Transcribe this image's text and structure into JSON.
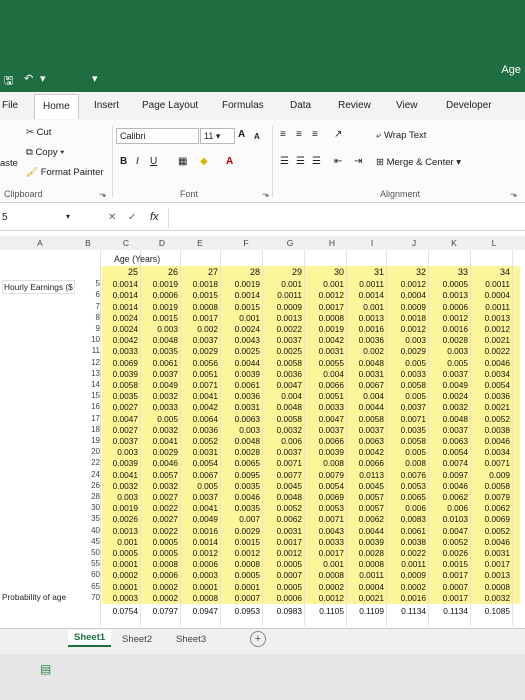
{
  "app": {
    "title": "Age"
  },
  "qat": {
    "save": "🖫",
    "undo": "↶",
    "redo": "▾",
    "customize": "▾"
  },
  "tabs": [
    "File",
    "Home",
    "Insert",
    "Page Layout",
    "Formulas",
    "Data",
    "Review",
    "View",
    "Developer"
  ],
  "ribbon": {
    "clipboard": {
      "cut": "Cut",
      "copy": "Copy",
      "format_painter": "Format Painter",
      "paste": "aste",
      "label": "Clipboard"
    },
    "font": {
      "name": "Calibri",
      "size": "11",
      "grow": "A",
      "shrink": "A",
      "bold": "B",
      "italic": "I",
      "underline": "U",
      "label": "Font"
    },
    "alignment": {
      "wrap": "Wrap Text",
      "merge": "Merge & Center",
      "label": "Alignment"
    }
  },
  "formula_bar": {
    "name_box": "5",
    "fx": "fx",
    "cancel": "✕",
    "enter": "✓"
  },
  "columns": [
    "A",
    "B",
    "C",
    "D",
    "E",
    "F",
    "G",
    "H",
    "I",
    "J",
    "K",
    "L"
  ],
  "side_labels": {
    "hourly": "Hourly Earnings ($",
    "probability": "Probability of age"
  },
  "age_label": "Age (Years)",
  "ages": [
    "25",
    "26",
    "27",
    "28",
    "29",
    "30",
    "31",
    "32",
    "33",
    "34"
  ],
  "rows": [
    {
      "n": "5",
      "v": [
        "0.0014",
        "0.0019",
        "0.0018",
        "0.0019",
        "0.001",
        "0.001",
        "0.0011",
        "0.0012",
        "0.0005",
        "0.0011"
      ]
    },
    {
      "n": "6",
      "v": [
        "0.0014",
        "0.0006",
        "0.0015",
        "0.0014",
        "0.0011",
        "0.0012",
        "0.0014",
        "0.0004",
        "0.0013",
        "0.0004"
      ]
    },
    {
      "n": "7",
      "v": [
        "0.0014",
        "0.0019",
        "0.0008",
        "0.0015",
        "0.0009",
        "0.0017",
        "0.001",
        "0.0009",
        "0.0006",
        "0.0011"
      ]
    },
    {
      "n": "8",
      "v": [
        "0.0024",
        "0.0015",
        "0.0017",
        "0.001",
        "0.0013",
        "0.0008",
        "0.0013",
        "0.0018",
        "0.0012",
        "0.0013"
      ]
    },
    {
      "n": "9",
      "v": [
        "0.0024",
        "0.003",
        "0.002",
        "0.0024",
        "0.0022",
        "0.0019",
        "0.0016",
        "0.0012",
        "0.0016",
        "0.0012"
      ]
    },
    {
      "n": "10",
      "v": [
        "0.0042",
        "0.0048",
        "0.0037",
        "0.0043",
        "0.0037",
        "0.0042",
        "0.0036",
        "0.003",
        "0.0028",
        "0.0021"
      ]
    },
    {
      "n": "11",
      "v": [
        "0.0033",
        "0.0035",
        "0.0029",
        "0.0025",
        "0.0025",
        "0.0031",
        "0.002",
        "0.0029",
        "0.003",
        "0.0022"
      ]
    },
    {
      "n": "12",
      "v": [
        "0.0069",
        "0.0061",
        "0.0056",
        "0.0044",
        "0.0058",
        "0.0055",
        "0.0048",
        "0.005",
        "0.005",
        "0.0046"
      ]
    },
    {
      "n": "13",
      "v": [
        "0.0039",
        "0.0037",
        "0.0051",
        "0.0039",
        "0.0036",
        "0.004",
        "0.0031",
        "0.0033",
        "0.0037",
        "0.0034"
      ]
    },
    {
      "n": "14",
      "v": [
        "0.0058",
        "0.0049",
        "0.0071",
        "0.0061",
        "0.0047",
        "0.0066",
        "0.0067",
        "0.0058",
        "0.0049",
        "0.0054"
      ]
    },
    {
      "n": "15",
      "v": [
        "0.0035",
        "0.0032",
        "0.0041",
        "0.0036",
        "0.004",
        "0.0051",
        "0.004",
        "0.005",
        "0.0024",
        "0.0036"
      ]
    },
    {
      "n": "16",
      "v": [
        "0.0027",
        "0.0033",
        "0.0042",
        "0.0031",
        "0.0048",
        "0.0033",
        "0.0044",
        "0.0037",
        "0.0032",
        "0.0021"
      ]
    },
    {
      "n": "17",
      "v": [
        "0.0047",
        "0.005",
        "0.0064",
        "0.0063",
        "0.0058",
        "0.0047",
        "0.0058",
        "0.0071",
        "0.0048",
        "0.0052"
      ]
    },
    {
      "n": "18",
      "v": [
        "0.0027",
        "0.0032",
        "0.0036",
        "0.003",
        "0.0032",
        "0.0037",
        "0.0037",
        "0.0035",
        "0.0037",
        "0.0038"
      ]
    },
    {
      "n": "19",
      "v": [
        "0.0037",
        "0.0041",
        "0.0052",
        "0.0048",
        "0.006",
        "0.0066",
        "0.0063",
        "0.0058",
        "0.0063",
        "0.0046"
      ]
    },
    {
      "n": "20",
      "v": [
        "0.003",
        "0.0029",
        "0.0031",
        "0.0028",
        "0.0037",
        "0.0039",
        "0.0042",
        "0.005",
        "0.0054",
        "0.0034"
      ]
    },
    {
      "n": "22",
      "v": [
        "0.0039",
        "0.0046",
        "0.0054",
        "0.0065",
        "0.0071",
        "0.008",
        "0.0066",
        "0.008",
        "0.0074",
        "0.0071"
      ]
    },
    {
      "n": "24",
      "v": [
        "0.0041",
        "0.0057",
        "0.0067",
        "0.0095",
        "0.0077",
        "0.0079",
        "0.0113",
        "0.0076",
        "0.0097",
        "0.009"
      ]
    },
    {
      "n": "26",
      "v": [
        "0.0032",
        "0.0032",
        "0.005",
        "0.0035",
        "0.0045",
        "0.0054",
        "0.0045",
        "0.0053",
        "0.0046",
        "0.0058"
      ]
    },
    {
      "n": "28",
      "v": [
        "0.003",
        "0.0027",
        "0.0037",
        "0.0046",
        "0.0048",
        "0.0069",
        "0.0057",
        "0.0065",
        "0.0062",
        "0.0079"
      ]
    },
    {
      "n": "30",
      "v": [
        "0.0019",
        "0.0022",
        "0.0041",
        "0.0035",
        "0.0052",
        "0.0053",
        "0.0057",
        "0.006",
        "0.006",
        "0.0062"
      ]
    },
    {
      "n": "35",
      "v": [
        "0.0026",
        "0.0027",
        "0.0049",
        "0.007",
        "0.0062",
        "0.0071",
        "0.0062",
        "0.0083",
        "0.0103",
        "0.0069"
      ]
    },
    {
      "n": "40",
      "v": [
        "0.0013",
        "0.0022",
        "0.0016",
        "0.0029",
        "0.0031",
        "0.0043",
        "0.0044",
        "0.0061",
        "0.0047",
        "0.0052"
      ]
    },
    {
      "n": "45",
      "v": [
        "0.001",
        "0.0005",
        "0.0014",
        "0.0015",
        "0.0017",
        "0.0033",
        "0.0039",
        "0.0038",
        "0.0052",
        "0.0046"
      ]
    },
    {
      "n": "50",
      "v": [
        "0.0005",
        "0.0005",
        "0.0012",
        "0.0012",
        "0.0012",
        "0.0017",
        "0.0028",
        "0.0022",
        "0.0026",
        "0.0031"
      ]
    },
    {
      "n": "55",
      "v": [
        "0.0001",
        "0.0008",
        "0.0006",
        "0.0008",
        "0.0005",
        "0.001",
        "0.0008",
        "0.0011",
        "0.0015",
        "0.0017"
      ]
    },
    {
      "n": "60",
      "v": [
        "0.0002",
        "0.0006",
        "0.0003",
        "0.0005",
        "0.0007",
        "0.0008",
        "0.0011",
        "0.0009",
        "0.0017",
        "0.0013"
      ]
    },
    {
      "n": "65",
      "v": [
        "0.0001",
        "0.0002",
        "0.0001",
        "0.0001",
        "0.0005",
        "0.0002",
        "0.0004",
        "0.0002",
        "0.0007",
        "0.0008"
      ]
    },
    {
      "n": "70",
      "v": [
        "0.0003",
        "0.0002",
        "0.0008",
        "0.0007",
        "0.0006",
        "0.0012",
        "0.0021",
        "0.0016",
        "0.0017",
        "0.0032"
      ]
    }
  ],
  "probability": [
    "0.0754",
    "0.0797",
    "0.0947",
    "0.0953",
    "0.0983",
    "0.1105",
    "0.1109",
    "0.1134",
    "0.1134",
    "0.1085"
  ],
  "sheets": [
    "Sheet1",
    "Sheet2",
    "Sheet3"
  ],
  "add_sheet": "+"
}
